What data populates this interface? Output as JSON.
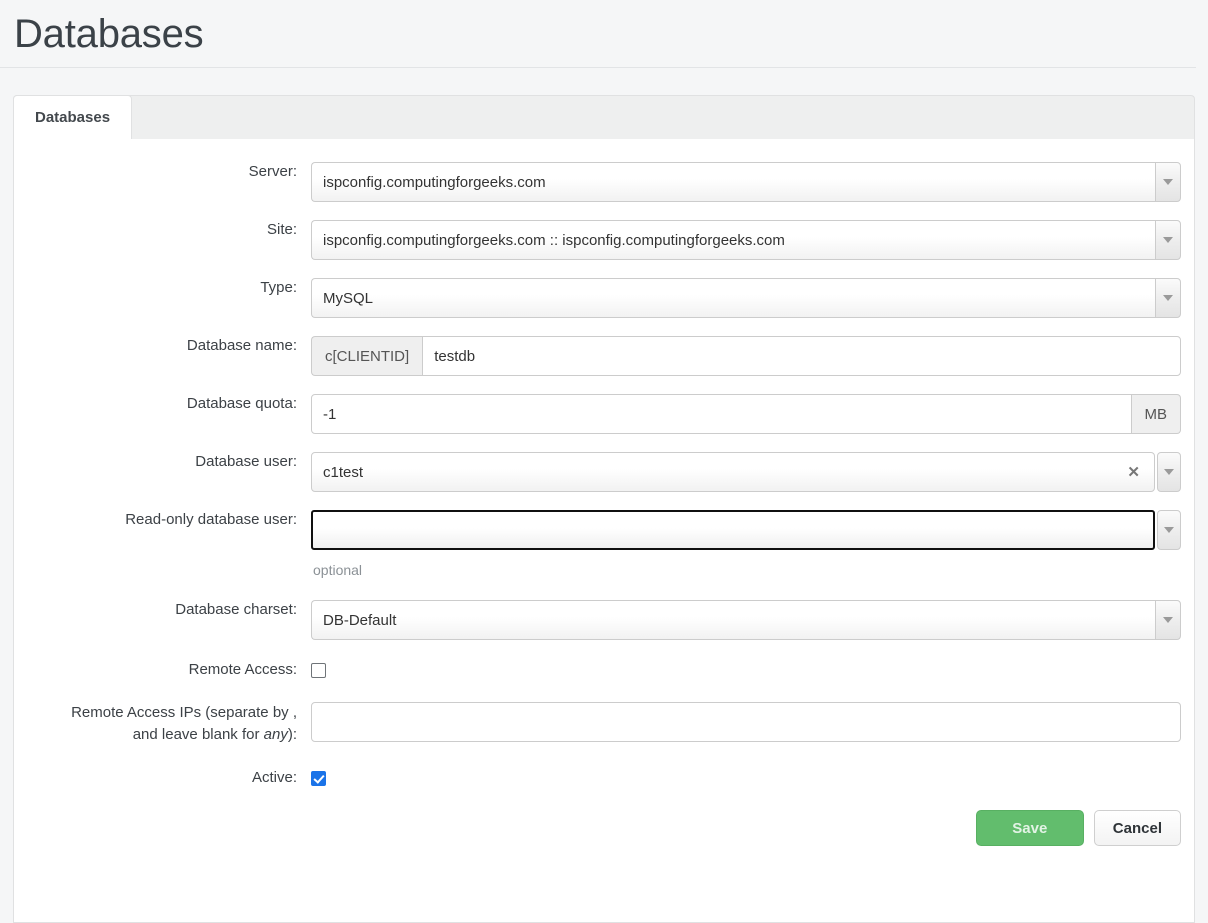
{
  "header": {
    "title": "Databases"
  },
  "tabs": [
    {
      "label": "Databases",
      "active": true
    }
  ],
  "form": {
    "server": {
      "label": "Server:",
      "value": "ispconfig.computingforgeeks.com",
      "control": "select"
    },
    "site": {
      "label": "Site:",
      "value": "ispconfig.computingforgeeks.com :: ispconfig.computingforgeeks.com",
      "control": "select"
    },
    "type": {
      "label": "Type:",
      "value": "MySQL",
      "control": "select"
    },
    "database_name": {
      "label": "Database name:",
      "prefix": "c[CLIENTID]",
      "value": "testdb",
      "control": "input-group"
    },
    "database_quota": {
      "label": "Database quota:",
      "value": "-1",
      "suffix": "MB",
      "control": "input-group"
    },
    "database_user": {
      "label": "Database user:",
      "value": "c1test",
      "clear_icon": "close-icon",
      "control": "combobox"
    },
    "readonly_database_user": {
      "label": "Read-only database user:",
      "value": "",
      "hint": "optional",
      "focused": true,
      "control": "combobox"
    },
    "database_charset": {
      "label": "Database charset:",
      "value": "DB-Default",
      "control": "select"
    },
    "remote_access": {
      "label": "Remote Access:",
      "checked": false,
      "control": "checkbox"
    },
    "remote_access_ips": {
      "label_line1": "Remote Access IPs (separate by ,",
      "label_line2_pre": "and leave blank for ",
      "label_line2_em": "any",
      "label_line2_post": "):",
      "value": "",
      "control": "input"
    },
    "active": {
      "label": "Active:",
      "checked": true,
      "control": "checkbox"
    }
  },
  "buttons": {
    "save": "Save",
    "cancel": "Cancel"
  },
  "colors": {
    "save_button": "#62bd6d",
    "checkbox_checked": "#1a73e8",
    "page_background": "#f5f6f7",
    "panel_background": "#ffffff"
  }
}
